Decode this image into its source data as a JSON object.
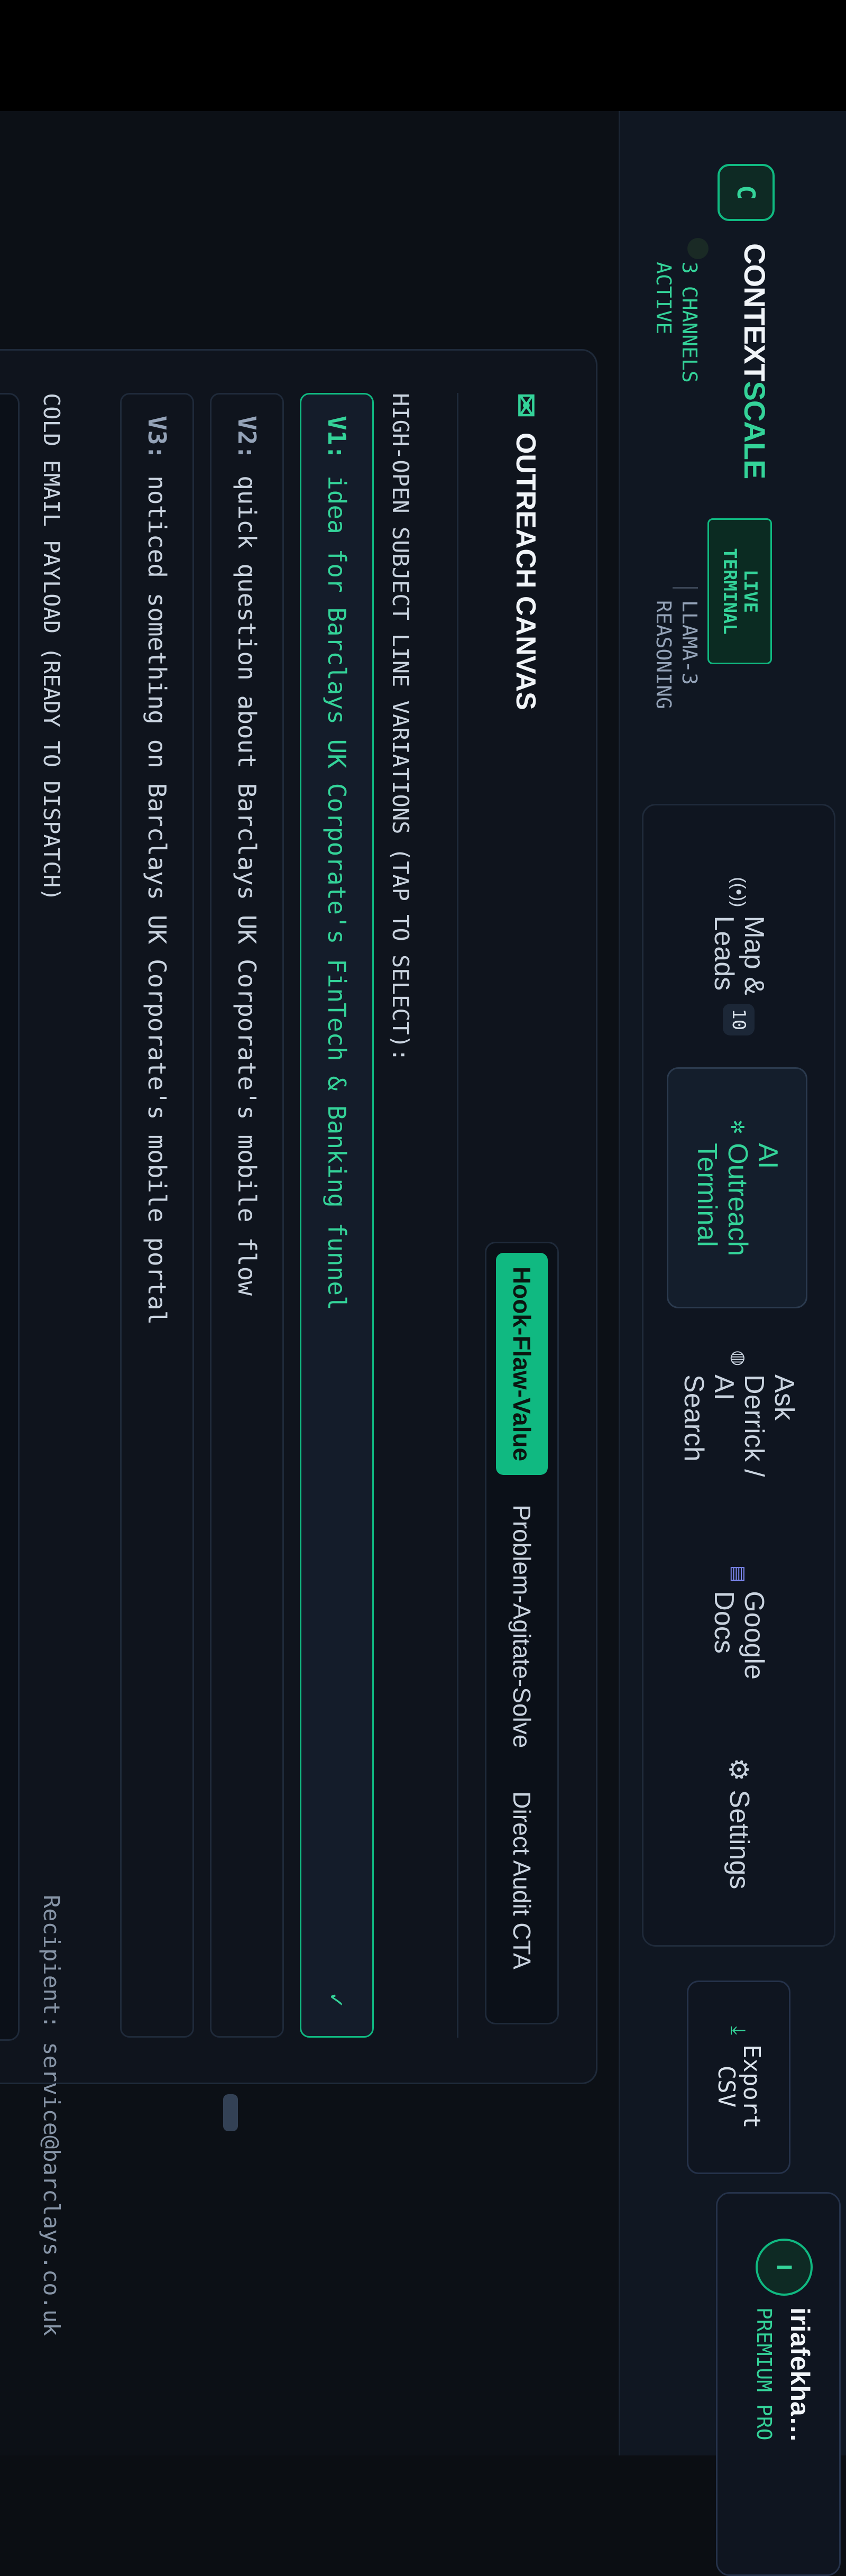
{
  "app": {
    "logo_letter": "C",
    "brand_main": "CONTEXT",
    "brand_accent": "SCALE",
    "live_badge_line1": "LIVE",
    "live_badge_line2": "TERMINAL",
    "status_line1": "3 CHANNELS",
    "status_line2": "ACTIVE",
    "model_line1": "LLAMA-3",
    "model_line2": "REASONING"
  },
  "nav": {
    "items": [
      {
        "label_line1": "Map &",
        "label_line2": "Leads",
        "icon": "radio-icon",
        "badge": "10"
      },
      {
        "label_line1": "AI",
        "label_line2": "Outreach",
        "label_line3": "Terminal",
        "icon": "sparkle-icon"
      },
      {
        "label_line1": "Ask",
        "label_line2": "Derrick /",
        "label_line3": "AI",
        "label_line4": "Search",
        "icon": "globe-icon"
      },
      {
        "label_line1": "Google",
        "label_line2": "Docs",
        "icon": "doc-icon"
      },
      {
        "label": "Settings",
        "icon": "gear-icon"
      }
    ],
    "export_line1": "Export",
    "export_line2": "CSV"
  },
  "user": {
    "initial": "I",
    "email": "iriafekhaid@gmai...",
    "plan": "PREMIUM PRO"
  },
  "canvas": {
    "title": "OUTREACH CANVAS",
    "tabs": [
      "Hook-Flaw-Value",
      "Problem-Agitate-Solve",
      "Direct Audit CTA"
    ],
    "subject_label": "HIGH-OPEN SUBJECT LINE VARIATIONS (TAP TO SELECT):",
    "variants": [
      {
        "tag": "V1:",
        "text": "idea for Barclays UK Corporate's FinTech & Banking funnel"
      },
      {
        "tag": "V2:",
        "text": "quick question about Barclays UK Corporate's mobile flow"
      },
      {
        "tag": "V3:",
        "text": "noticed something on Barclays UK Corporate's mobile portal"
      }
    ],
    "payload_label": "COLD EMAIL PAYLOAD (READY TO DISPATCH)",
    "recipient": "Recipient: service@barclays.co.uk"
  },
  "colors": {
    "accent": "#10b981",
    "background": "#0c1016"
  }
}
